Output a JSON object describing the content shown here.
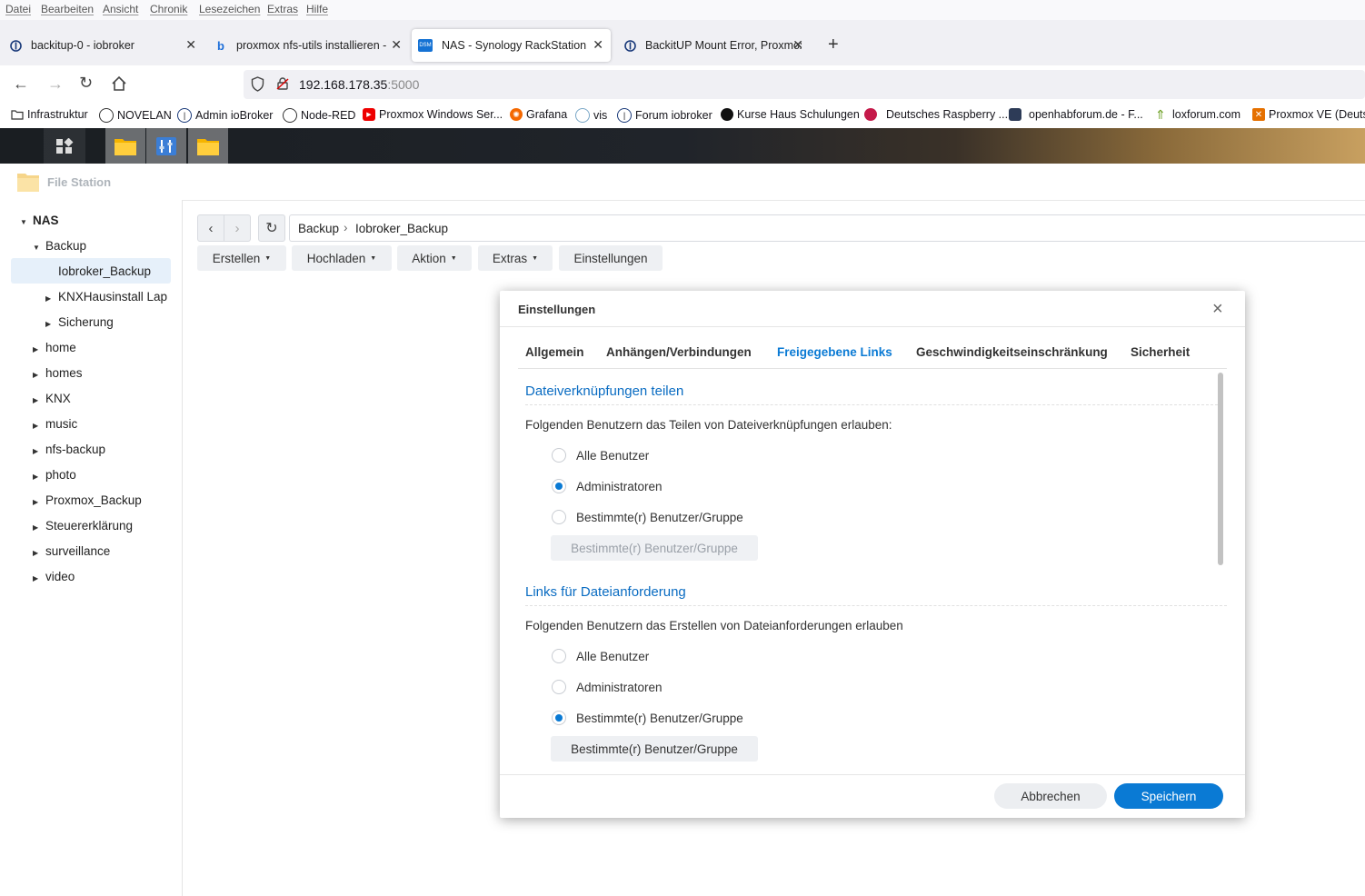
{
  "browser": {
    "menu": [
      "Datei",
      "Bearbeiten",
      "Ansicht",
      "Chronik",
      "Lesezeichen",
      "Extras",
      "Hilfe"
    ],
    "tabs": [
      {
        "label": "backitup-0 - iobroker",
        "icon": "iobroker-icon"
      },
      {
        "label": "proxmox nfs-utils installieren - ",
        "icon": "bing-icon"
      },
      {
        "label": "NAS - Synology RackStation",
        "icon": "dsm-icon",
        "badge": "DSM"
      },
      {
        "label": "BackitUP Mount Error, Proxmox",
        "icon": "iobroker-icon"
      }
    ],
    "new_tab": "+",
    "url_host": "192.168.178.35",
    "url_port": ":5000",
    "bookmarks": [
      "Infrastruktur",
      "NOVELAN",
      "Admin ioBroker",
      "Node-RED",
      "Proxmox Windows Ser...",
      "Grafana",
      "vis",
      "Forum iobroker",
      "Kurse Haus Schulungen",
      "Deutsches Raspberry ...",
      "openhabforum.de - F...",
      "loxforum.com",
      "Proxmox VE (Deutsch)"
    ]
  },
  "filestation": {
    "title": "File Station",
    "tree": {
      "root": "NAS",
      "items": [
        "Backup",
        "Iobroker_Backup",
        "KNXHausinstall Lap",
        "Sicherung",
        "home",
        "homes",
        "KNX",
        "music",
        "nfs-backup",
        "photo",
        "Proxmox_Backup",
        "Steuererklärung",
        "surveillance",
        "video"
      ]
    },
    "path": [
      "Backup",
      "Iobroker_Backup"
    ],
    "path_sep": "›",
    "toolbar": [
      "Erstellen",
      "Hochladen",
      "Aktion",
      "Extras",
      "Einstellungen"
    ]
  },
  "dialog": {
    "title": "Einstellungen",
    "close": "×",
    "tabs": [
      "Allgemein",
      "Anhängen/Verbindungen",
      "Freigegebene Links",
      "Geschwindigkeitseinschränkung",
      "Sicherheit"
    ],
    "active_tab": "Freigegebene Links",
    "section1": {
      "heading": "Dateiverknüpfungen teilen",
      "desc": "Folgenden Benutzern das Teilen von Dateiverknüpfungen erlauben:",
      "options": [
        "Alle Benutzer",
        "Administratoren",
        "Bestimmte(r) Benutzer/Gruppe"
      ],
      "selected": "Administratoren",
      "button": "Bestimmte(r) Benutzer/Gruppe"
    },
    "section2": {
      "heading": "Links für Dateianforderung",
      "desc": "Folgenden Benutzern das Erstellen von Dateianforderungen erlauben",
      "options": [
        "Alle Benutzer",
        "Administratoren",
        "Bestimmte(r) Benutzer/Gruppe"
      ],
      "selected": "Bestimmte(r) Benutzer/Gruppe",
      "button": "Bestimmte(r) Benutzer/Gruppe"
    },
    "cancel": "Abbrechen",
    "save": "Speichern"
  },
  "colors": {
    "accent": "#0a7ad4",
    "heading": "#0a6cc2",
    "selected_bg": "#e6f0fa"
  }
}
